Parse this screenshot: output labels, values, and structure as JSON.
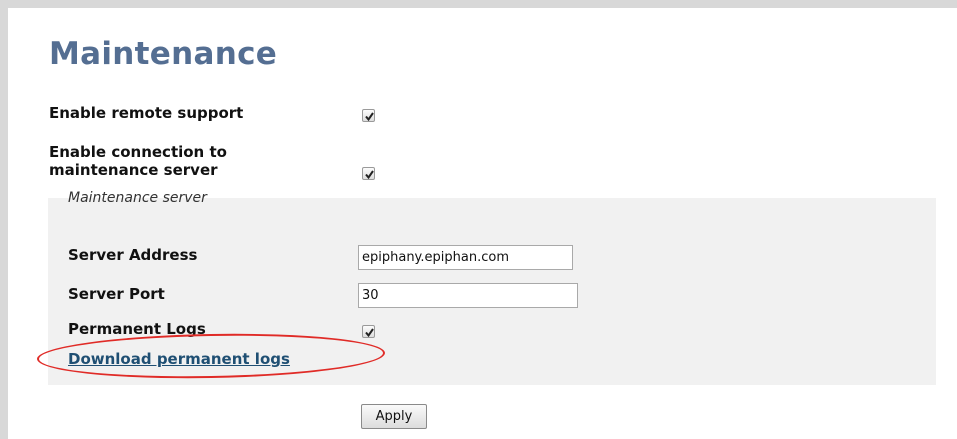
{
  "page": {
    "title": "Maintenance"
  },
  "settings": {
    "remote_support": {
      "label": "Enable remote support",
      "checked": true
    },
    "maintenance_connection": {
      "label_line1": "Enable connection to",
      "label_line2": "maintenance server",
      "checked": true
    }
  },
  "server_section": {
    "legend": "Maintenance server",
    "address": {
      "label": "Server Address",
      "value": "epiphany.epiphan.com"
    },
    "port": {
      "label": "Server Port",
      "value": "30"
    },
    "permanent_logs": {
      "label": "Permanent Logs",
      "checked": true
    },
    "download_link": "Download permanent logs"
  },
  "actions": {
    "apply_label": "Apply"
  },
  "colors": {
    "title": "#546e92",
    "link": "#1f4f73",
    "highlight_oval": "#e02b27",
    "panel_bg": "#f1f1f1"
  },
  "icons": {
    "checkbox_mark": "checkmark-icon"
  }
}
